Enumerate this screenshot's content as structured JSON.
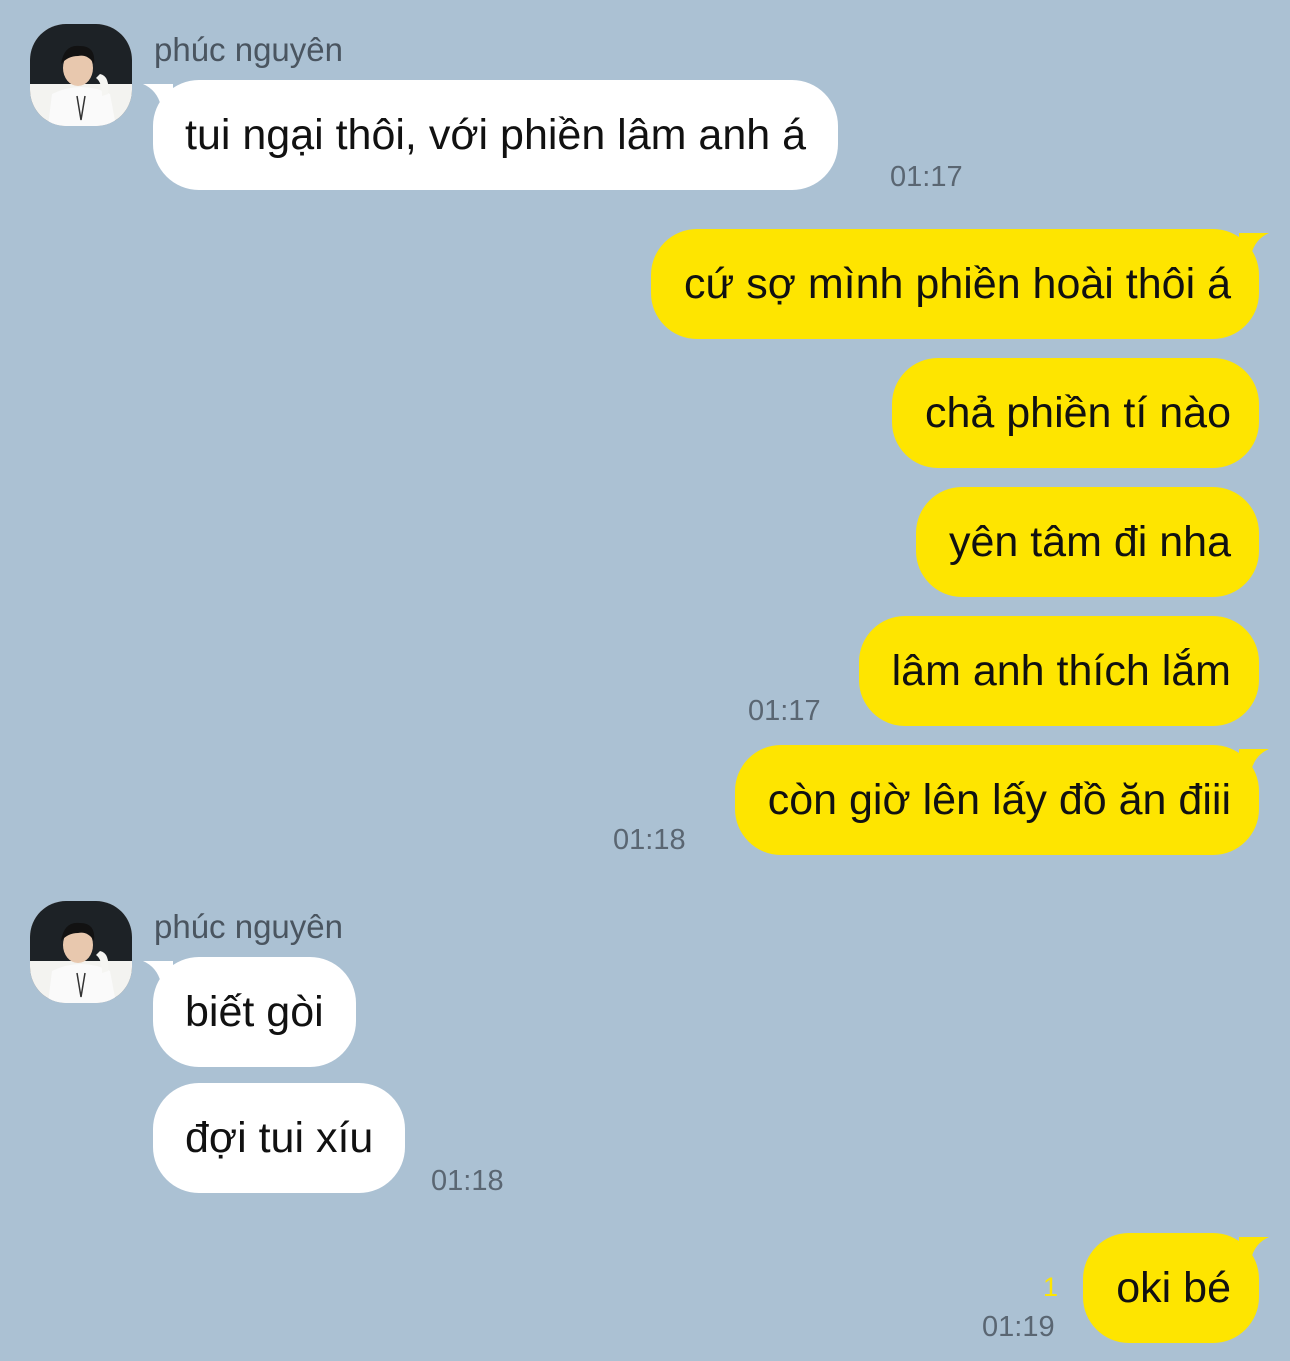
{
  "colors": {
    "background": "#abc1d3",
    "incoming_bubble": "#ffffff",
    "outgoing_bubble": "#fee500",
    "timestamp": "#5a6672",
    "unread_count": "#fee500"
  },
  "chat": {
    "groups": [
      {
        "sender": "phúc nguyên",
        "messages": [
          {
            "text": "tui ngại thôi, với phiền lâm anh á",
            "time": "01:17"
          }
        ]
      },
      {
        "messages": [
          {
            "text": "cứ sợ mình phiền hoài thôi á"
          },
          {
            "text": "chả phiền tí nào"
          },
          {
            "text": "yên tâm đi nha"
          },
          {
            "text": "lâm anh thích lắm",
            "time": "01:17"
          },
          {
            "text": "còn giờ lên lấy đồ ăn điii",
            "time": "01:18"
          }
        ]
      },
      {
        "sender": "phúc nguyên",
        "messages": [
          {
            "text": "biết gòi"
          },
          {
            "text": "đợi tui xíu",
            "time": "01:18"
          }
        ]
      },
      {
        "messages": [
          {
            "text": "oki bé",
            "time": "01:19",
            "unread": "1"
          }
        ]
      }
    ]
  }
}
